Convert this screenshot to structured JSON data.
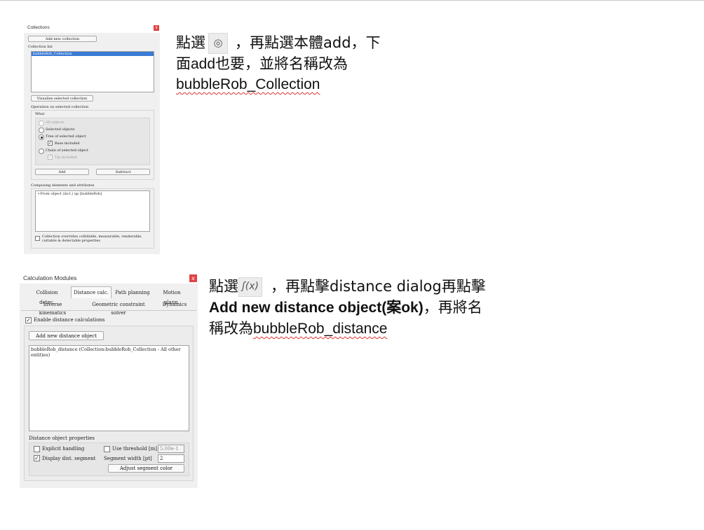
{
  "collections_dialog": {
    "title": "Collections",
    "close": "x",
    "add_new_button": "Add new collection",
    "list_label": "Collection list",
    "list_items": [
      "bubbleRob_Collection"
    ],
    "visualize_button": "Visualize selected collection",
    "operation_label": "Operation on selected collection",
    "what_label": "What",
    "options": [
      {
        "label": "All objects",
        "selected": false,
        "disabled": true
      },
      {
        "label": "Selected objects",
        "selected": false,
        "disabled": false
      },
      {
        "label": "Tree of selected object",
        "selected": true,
        "disabled": false
      },
      {
        "label": "Chain of selected object",
        "selected": false,
        "disabled": false
      }
    ],
    "base_included": "Base included",
    "tip_included": "Tip included",
    "add_button": "Add",
    "subtract_button": "Subtract",
    "composing_label": "Composing elements and attributes",
    "composing_items": [
      "+From object (incl.) up [bubbleRob]"
    ],
    "override_line1": "Collection overrides collidable, measurable, renderable,",
    "override_line2": "cuttable & detectable properties"
  },
  "calc_dialog": {
    "title": "Calculation Modules",
    "close": "x",
    "tabs_row1": [
      "Collision detec.",
      "Distance calc.",
      "Path planning",
      "Motion plann."
    ],
    "tabs_row2": [
      "Inverse kinematics",
      "Geometric constraint solver",
      "Dynamics"
    ],
    "active_tab": "Distance calc.",
    "enable_label": "Enable distance calculations",
    "enable_checked": true,
    "add_button": "Add new distance object",
    "list_items": [
      "bubbleRob_distance (Collection:bubbleRob_Collection - All other entities)"
    ],
    "props_label": "Distance object properties",
    "explicit_handling": "Explicit handling",
    "use_threshold": "Use threshold [m]",
    "threshold_value": "5.00e-1",
    "display_segment": "Display dist. segment",
    "segment_width_label": "Segment width [pt]",
    "segment_width_value": "2",
    "adjust_color_button": "Adjust segment color"
  },
  "instructions": {
    "first": {
      "p1": "點選",
      "p2": "，再點選本體add，下",
      "line2": "面add也要，並將名稱改為",
      "line3": "bubbleRob_Collection"
    },
    "second": {
      "p1": "點選",
      "p2": "，再點擊distance dialog再點擊",
      "line2a": "Add new distance object(案ok)",
      "line2b": "，再將名",
      "line3a": "稱改為",
      "line3b": "bubbleRob_distance"
    }
  },
  "icons": {
    "collection_icon": "collection-icon",
    "function_icon": "function-icon",
    "function_icon_glyph": "ʃ(x)"
  }
}
